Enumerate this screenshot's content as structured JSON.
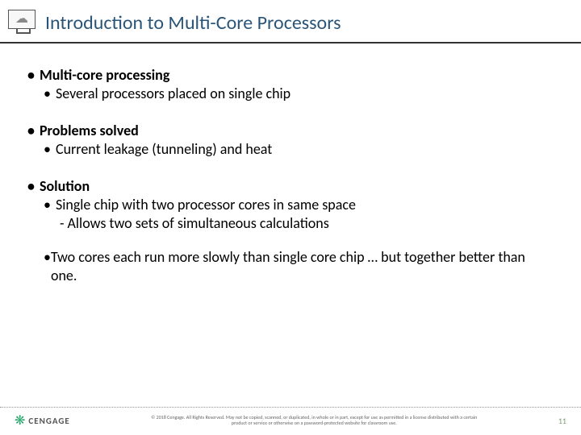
{
  "header": {
    "title": "Introduction to Multi-Core Processors"
  },
  "content": {
    "b1": {
      "head": "Multi-core processing",
      "sub1": "Several processors placed on single chip"
    },
    "b2": {
      "head": "Problems solved",
      "sub1": "Current leakage (tunneling) and heat"
    },
    "b3": {
      "head": "Solution",
      "sub1": "Single chip with two processor cores in same space",
      "sub1a": "Allows two sets of simultaneous calculations",
      "sub2": "Two cores each run more slowly than single core chip … but together better than one."
    }
  },
  "footer": {
    "brand": "CENGAGE",
    "copyright": "© 2018 Cengage. All Rights Reserved. May not be copied, scanned, or duplicated, in whole or in part, except for use as permitted in a license distributed with a certain product or service or otherwise on a password-protected website for classroom use.",
    "page": "11"
  }
}
